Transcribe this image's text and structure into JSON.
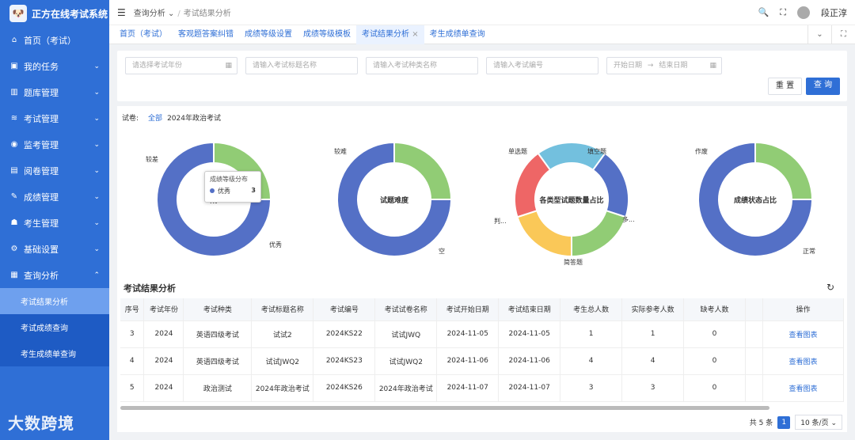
{
  "app": {
    "title": "正方在线考试系统",
    "logo_text": "狗"
  },
  "sidebar": {
    "items": [
      {
        "icon": "home-icon",
        "glyph": "⌂",
        "label": "首页（考试）"
      },
      {
        "icon": "task-icon",
        "glyph": "▣",
        "label": "我的任务"
      },
      {
        "icon": "bank-icon",
        "glyph": "▥",
        "label": "题库管理"
      },
      {
        "icon": "layers-icon",
        "glyph": "≋",
        "label": "考试管理"
      },
      {
        "icon": "monitor-icon",
        "glyph": "◉",
        "label": "监考管理"
      },
      {
        "icon": "paper-icon",
        "glyph": "▤",
        "label": "阅卷管理"
      },
      {
        "icon": "edit-icon",
        "glyph": "✎",
        "label": "成绩管理"
      },
      {
        "icon": "people-icon",
        "glyph": "☗",
        "label": "考生管理"
      },
      {
        "icon": "settings-icon",
        "glyph": "⚙",
        "label": "基础设置"
      },
      {
        "icon": "query-icon",
        "glyph": "▦",
        "label": "查询分析"
      }
    ],
    "sub_items": [
      "考试结果分析",
      "考试成绩查询",
      "考生成绩单查询"
    ],
    "brand": "大数跨境"
  },
  "topbar": {
    "bc1": "查询分析",
    "bc2": "考试结果分析",
    "user": "段正淳"
  },
  "tabs": [
    "首页（考试）",
    "客观题答案纠错",
    "成绩等级设置",
    "成绩等级模板",
    "考试结果分析",
    "考生成绩单查询"
  ],
  "filter": {
    "year": "请选择考试年份",
    "title": "请输入考试标题名称",
    "kind": "请输入考试种类名称",
    "no": "请输入考试编号",
    "start": "开始日期",
    "end": "结束日期",
    "reset": "重 置",
    "search": "查 询"
  },
  "paper": {
    "label": "试卷:",
    "all": "全部",
    "name": "2024年政治考试"
  },
  "charts": [
    {
      "center": "成",
      "labels": [
        "较差",
        "优秀"
      ],
      "colors": [
        "#91cc75",
        "#5470c6"
      ],
      "values": [
        25,
        75
      ]
    },
    {
      "center": "试题难度",
      "labels": [
        "较难",
        "空"
      ],
      "colors": [
        "#91cc75",
        "#5470c6"
      ],
      "values": [
        25,
        75
      ]
    },
    {
      "center": "各类型试题数量占比",
      "labels": [
        "单选题",
        "填空题",
        "多...",
        "简答题",
        "判..."
      ],
      "colors": [
        "#73c0de",
        "#5470c6",
        "#91cc75",
        "#fac858",
        "#ee6666"
      ],
      "values": [
        20,
        20,
        20,
        20,
        20
      ]
    },
    {
      "center": "成绩状态占比",
      "labels": [
        "作废",
        "正常"
      ],
      "colors": [
        "#91cc75",
        "#5470c6"
      ],
      "values": [
        25,
        75
      ]
    }
  ],
  "tooltip": {
    "title": "成绩等级分布",
    "name": "优秀",
    "value": "3"
  },
  "section": {
    "title": "考试结果分析"
  },
  "table": {
    "headers": [
      "序号",
      "考试年份",
      "考试种类",
      "考试标题名称",
      "考试编号",
      "考试试卷名称",
      "考试开始日期",
      "考试结束日期",
      "考生总人数",
      "实际参考人数",
      "缺考人数",
      "",
      "操作"
    ],
    "rows": [
      [
        "3",
        "2024",
        "英语四级考试",
        "试试2",
        "2024KS22",
        "试试JWQ",
        "2024-11-05",
        "2024-11-05",
        "1",
        "1",
        "0",
        "",
        "查看图表"
      ],
      [
        "4",
        "2024",
        "英语四级考试",
        "试试JWQ2",
        "2024KS23",
        "试试JWQ2",
        "2024-11-06",
        "2024-11-06",
        "4",
        "4",
        "0",
        "",
        "查看图表"
      ],
      [
        "5",
        "2024",
        "政治测试",
        "2024年政治考试",
        "2024KS26",
        "2024年政治考试",
        "2024-11-07",
        "2024-11-07",
        "3",
        "3",
        "0",
        "",
        "查看图表"
      ]
    ]
  },
  "pager": {
    "total": "共 5 条",
    "page": "1",
    "size": "10 条/页"
  }
}
